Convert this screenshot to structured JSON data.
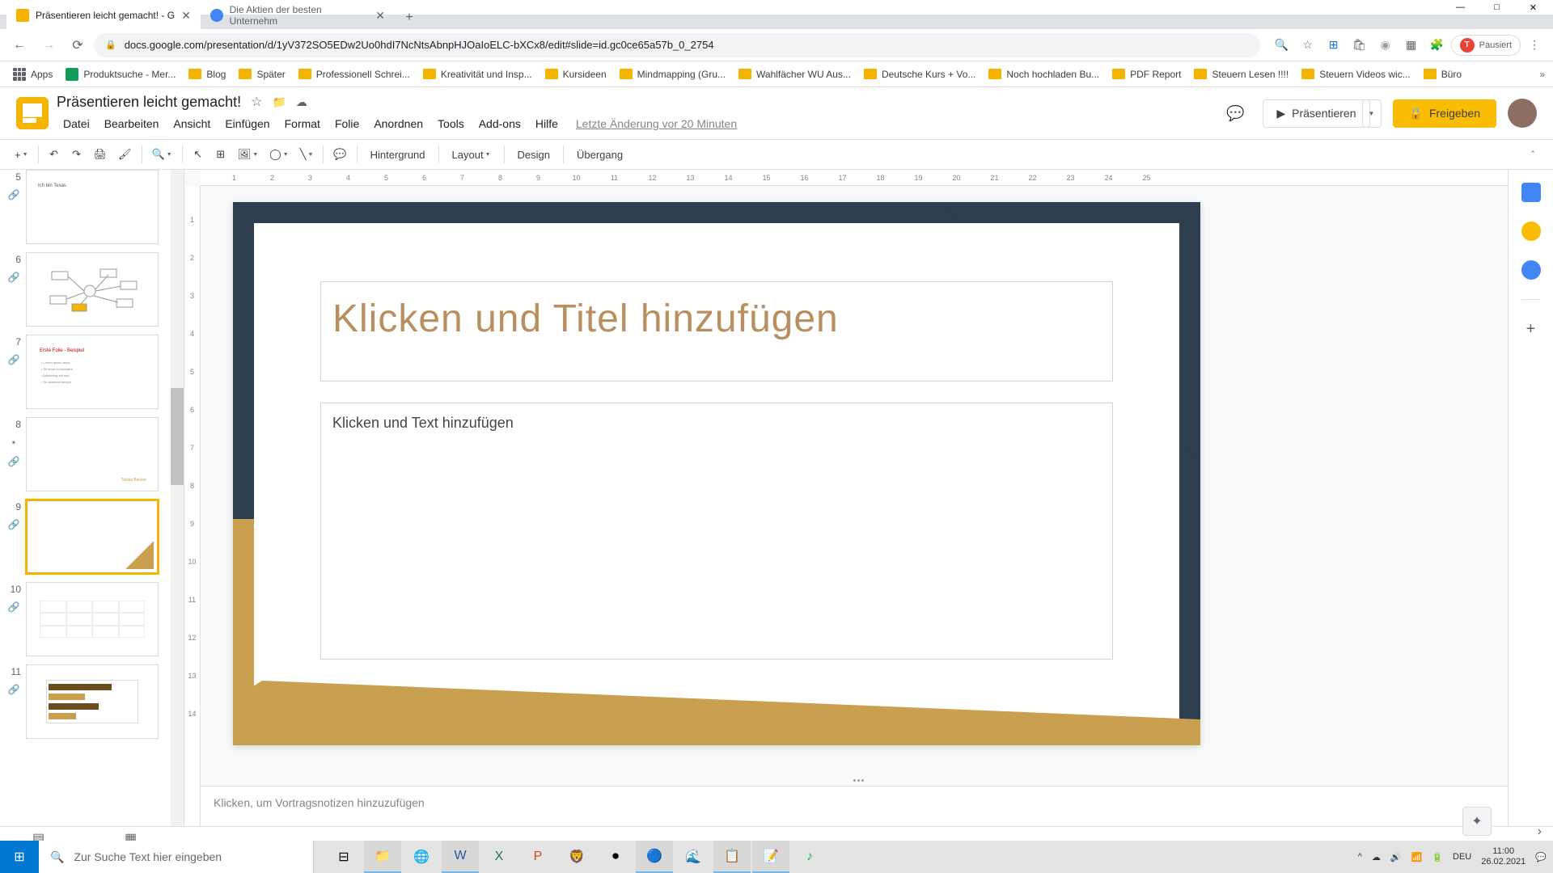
{
  "window": {
    "minimize": "—",
    "maximize": "□",
    "close": "✕"
  },
  "tabs": [
    {
      "title": "Präsentieren leicht gemacht! - G",
      "active": true
    },
    {
      "title": "Die Aktien der besten Unternehm",
      "active": false
    }
  ],
  "url": "docs.google.com/presentation/d/1yV372SO5EDw2Uo0hdI7NcNtsAbnpHJOaIoELC-bXCx8/edit#slide=id.gc0ce65a57b_0_2754",
  "pause_label": "Pausiert",
  "bookmarks": [
    "Apps",
    "Produktsuche - Mer...",
    "Blog",
    "Später",
    "Professionell Schrei...",
    "Kreativität und Insp...",
    "Kursideen",
    "Mindmapping (Gru...",
    "Wahlfächer WU Aus...",
    "Deutsche Kurs + Vo...",
    "Noch hochladen Bu...",
    "PDF Report",
    "Steuern Lesen !!!!",
    "Steuern Videos wic...",
    "Büro"
  ],
  "doc": {
    "name": "Präsentieren leicht gemacht!"
  },
  "buttons": {
    "present": "Präsentieren",
    "share": "Freigeben"
  },
  "menu": [
    "Datei",
    "Bearbeiten",
    "Ansicht",
    "Einfügen",
    "Format",
    "Folie",
    "Anordnen",
    "Tools",
    "Add-ons",
    "Hilfe"
  ],
  "last_edit": "Letzte Änderung vor 20 Minuten",
  "toolbar": {
    "bg": "Hintergrund",
    "layout": "Layout",
    "design": "Design",
    "transition": "Übergang"
  },
  "slide": {
    "title_placeholder": "Klicken und Titel hinzufügen",
    "body_placeholder": "Klicken und Text hinzufügen"
  },
  "notes_placeholder": "Klicken, um Vortragsnotizen hinzuzufügen",
  "thumbs": [
    {
      "num": "5",
      "label": "Ich bin Texas"
    },
    {
      "num": "6",
      "label": "Mindmap"
    },
    {
      "num": "7",
      "label": "Erste Folie - Beispiel"
    },
    {
      "num": "8",
      "label": ""
    },
    {
      "num": "9",
      "label": "",
      "selected": true
    },
    {
      "num": "10",
      "label": ""
    },
    {
      "num": "11",
      "label": ""
    }
  ],
  "ruler_h": [
    "1",
    "2",
    "3",
    "4",
    "5",
    "6",
    "7",
    "8",
    "9",
    "10",
    "11",
    "12",
    "13",
    "14",
    "15",
    "16",
    "17",
    "18",
    "19",
    "20",
    "21",
    "22",
    "23",
    "24",
    "25"
  ],
  "ruler_v": [
    "1",
    "2",
    "3",
    "4",
    "5",
    "6",
    "7",
    "8",
    "9",
    "10",
    "11",
    "12",
    "13",
    "14"
  ],
  "search_placeholder": "Zur Suche Text hier eingeben",
  "tray": {
    "lang": "DEU",
    "time": "11:00",
    "date": "26.02.2021"
  }
}
